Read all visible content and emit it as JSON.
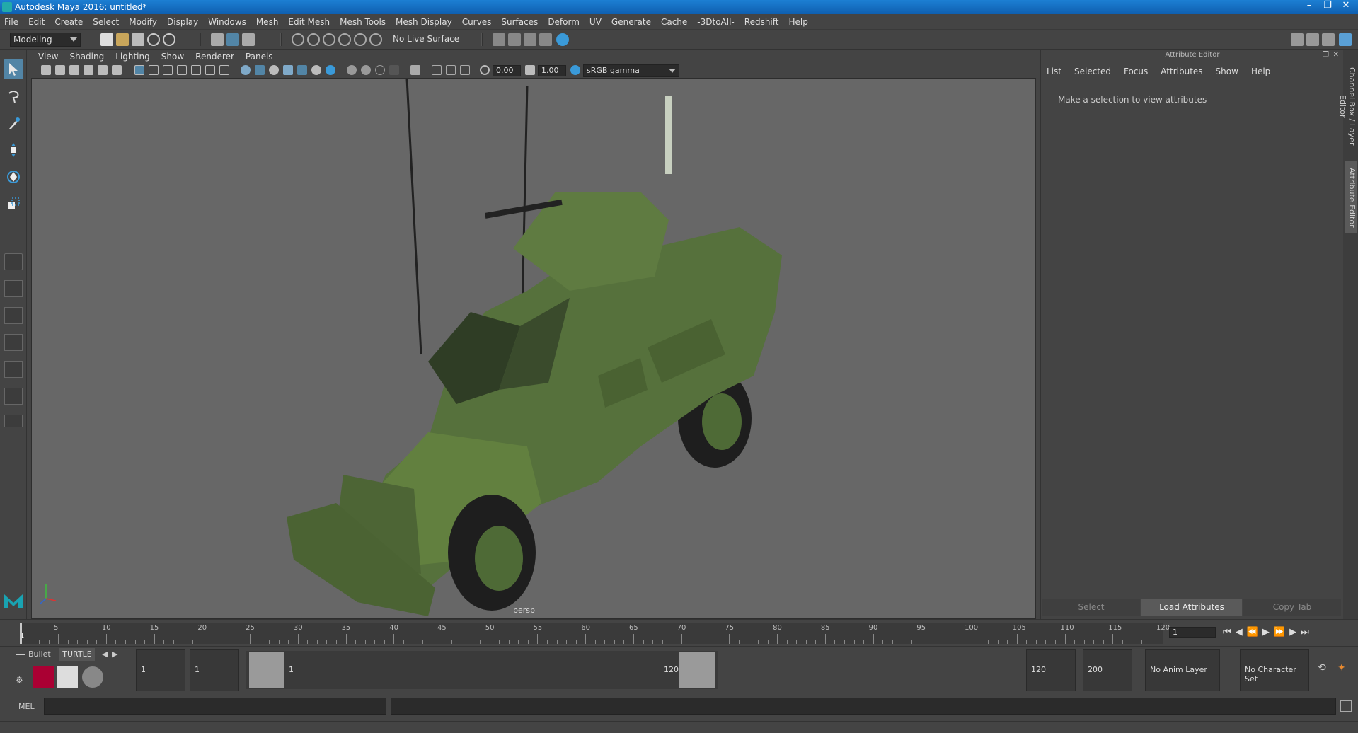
{
  "window": {
    "title": "Autodesk Maya 2016: untitled*"
  },
  "menubar": [
    "File",
    "Edit",
    "Create",
    "Select",
    "Modify",
    "Display",
    "Windows",
    "Mesh",
    "Edit Mesh",
    "Mesh Tools",
    "Mesh Display",
    "Curves",
    "Surfaces",
    "Deform",
    "UV",
    "Generate",
    "Cache",
    "-3DtoAll-",
    "Redshift",
    "Help"
  ],
  "statusline": {
    "mode": "Modeling",
    "live_surface": "No Live Surface"
  },
  "panel": {
    "menu": [
      "View",
      "Shading",
      "Lighting",
      "Show",
      "Renderer",
      "Panels"
    ],
    "exposure": "0.00",
    "gamma": "1.00",
    "colorspace": "sRGB gamma",
    "camera_label": "persp"
  },
  "attribute_editor": {
    "title": "Attribute Editor",
    "menu": [
      "List",
      "Selected",
      "Focus",
      "Attributes",
      "Show",
      "Help"
    ],
    "message": "Make a selection to view attributes",
    "buttons": {
      "select": "Select",
      "load": "Load Attributes",
      "copy": "Copy Tab"
    }
  },
  "side_tabs": {
    "channel_box": "Channel Box / Layer Editor",
    "attribute_editor": "Attribute Editor"
  },
  "timeline": {
    "start_label": "1",
    "ticks": [
      "5",
      "10",
      "15",
      "20",
      "25",
      "30",
      "35",
      "40",
      "45",
      "50",
      "55",
      "60",
      "65",
      "70",
      "75",
      "80",
      "85",
      "90",
      "95",
      "100",
      "105",
      "110",
      "115",
      "120"
    ],
    "current_frame": "1"
  },
  "range": {
    "shelf_tabs": [
      "Bullet",
      "TURTLE"
    ],
    "start_time": "1",
    "playback_start": "1",
    "slider_start": "1",
    "slider_end": "120",
    "playback_end": "120",
    "end_time": "200",
    "anim_layer": "No Anim Layer",
    "character_set": "No Character Set"
  },
  "command": {
    "lang": "MEL"
  }
}
